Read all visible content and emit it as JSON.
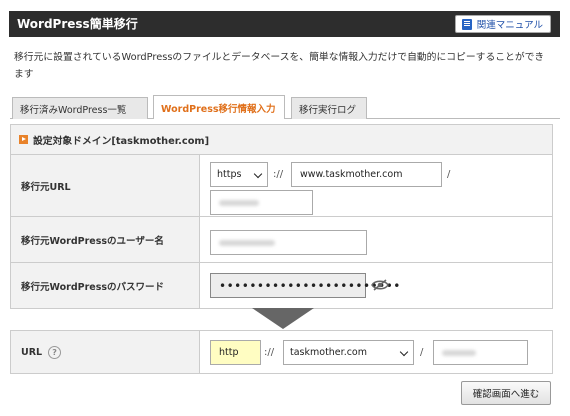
{
  "header": {
    "title": "WordPress簡単移行",
    "manual_label": "関連マニュアル"
  },
  "description": "移行元に設置されているWordPressのファイルとデータベースを、簡単な情報入力だけで自動的にコピーすることができます",
  "tabs": [
    {
      "label": "移行済みWordPress一覧",
      "active": false
    },
    {
      "label": "WordPress移行情報入力",
      "active": true
    },
    {
      "label": "移行実行ログ",
      "active": false
    }
  ],
  "section": {
    "title": "設定対象ドメイン[taskmother.com]"
  },
  "form": {
    "source_url": {
      "label": "移行元URL",
      "protocol": "https",
      "separator": "://",
      "domain": "www.taskmother.com",
      "slash": "/"
    },
    "wp_user": {
      "label": "移行元WordPressのユーザー名"
    },
    "wp_password": {
      "label": "移行元WordPressのパスワード",
      "value": "••••••••••••••••••••••••"
    }
  },
  "destination": {
    "label": "URL",
    "help": "?",
    "protocol": "http",
    "separator": "://",
    "domain": "taskmother.com",
    "slash": "/"
  },
  "confirm_label": "確認画面へ進む",
  "colors": {
    "header_bg": "#2d2d2d",
    "active_tab": "#e0701b",
    "accent_orange": "#e8822a",
    "link_blue": "#1f4fa8"
  }
}
